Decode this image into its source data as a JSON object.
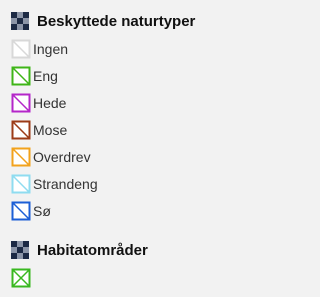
{
  "groups": [
    {
      "title": "Beskyttede naturtyper",
      "icon": "layer-group-icon",
      "items": [
        {
          "label": "Ingen",
          "color": "#d8d8d8"
        },
        {
          "label": "Eng",
          "color": "#3fb518"
        },
        {
          "label": "Hede",
          "color": "#b426c9"
        },
        {
          "label": "Mose",
          "color": "#9c3b17"
        },
        {
          "label": "Overdrev",
          "color": "#f2a21c"
        },
        {
          "label": "Strandeng",
          "color": "#8fdcf0"
        },
        {
          "label": "Sø",
          "color": "#1c5fd6"
        }
      ]
    },
    {
      "title": "Habitatområder",
      "icon": "layer-group-icon",
      "items": [
        {
          "label": "",
          "color": "#39b820",
          "pattern": "crosshatch"
        }
      ]
    }
  ]
}
